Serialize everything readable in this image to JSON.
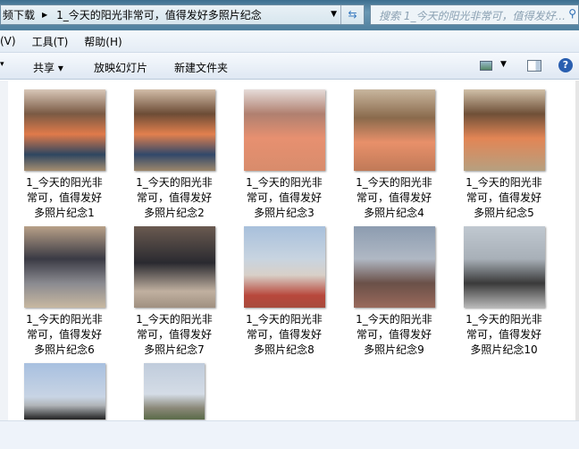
{
  "address": {
    "crumb_parent": "频下载",
    "crumb_current": "1_今天的阳光非常可，值得发好多照片纪念"
  },
  "search": {
    "placeholder": "搜索 1_今天的阳光非常可，值得发好..."
  },
  "menu": [
    "(V)",
    "工具(T)",
    "帮助(H)"
  ],
  "toolbar": {
    "share": "共享 ▾",
    "slideshow": "放映幻灯片",
    "new_folder": "新建文件夹"
  },
  "files": [
    {
      "name": "1_今天的阳光非常可，值得发好多照片纪念1",
      "l1": "1_今天的阳光非",
      "l2": "常可，值得发好",
      "l3": "多照片纪念1"
    },
    {
      "name": "2",
      "l1": "1_今天的阳光非",
      "l2": "常可，值得发好",
      "l3": "多照片纪念2"
    },
    {
      "name": "3",
      "l1": "1_今天的阳光非",
      "l2": "常可，值得发好",
      "l3": "多照片纪念3"
    },
    {
      "name": "4",
      "l1": "1_今天的阳光非",
      "l2": "常可，值得发好",
      "l3": "多照片纪念4"
    },
    {
      "name": "5",
      "l1": "1_今天的阳光非",
      "l2": "常可，值得发好",
      "l3": "多照片纪念5"
    },
    {
      "name": "6",
      "l1": "1_今天的阳光非",
      "l2": "常可，值得发好",
      "l3": "多照片纪念6"
    },
    {
      "name": "7",
      "l1": "1_今天的阳光非",
      "l2": "常可，值得发好",
      "l3": "多照片纪念7"
    },
    {
      "name": "8",
      "l1": "1_今天的阳光非",
      "l2": "常可，值得发好",
      "l3": "多照片纪念8"
    },
    {
      "name": "9",
      "l1": "1_今天的阳光非",
      "l2": "常可，值得发好",
      "l3": "多照片纪念9"
    },
    {
      "name": "10",
      "l1": "1_今天的阳光非",
      "l2": "常可，值得发好",
      "l3": "多照片纪念10"
    }
  ]
}
